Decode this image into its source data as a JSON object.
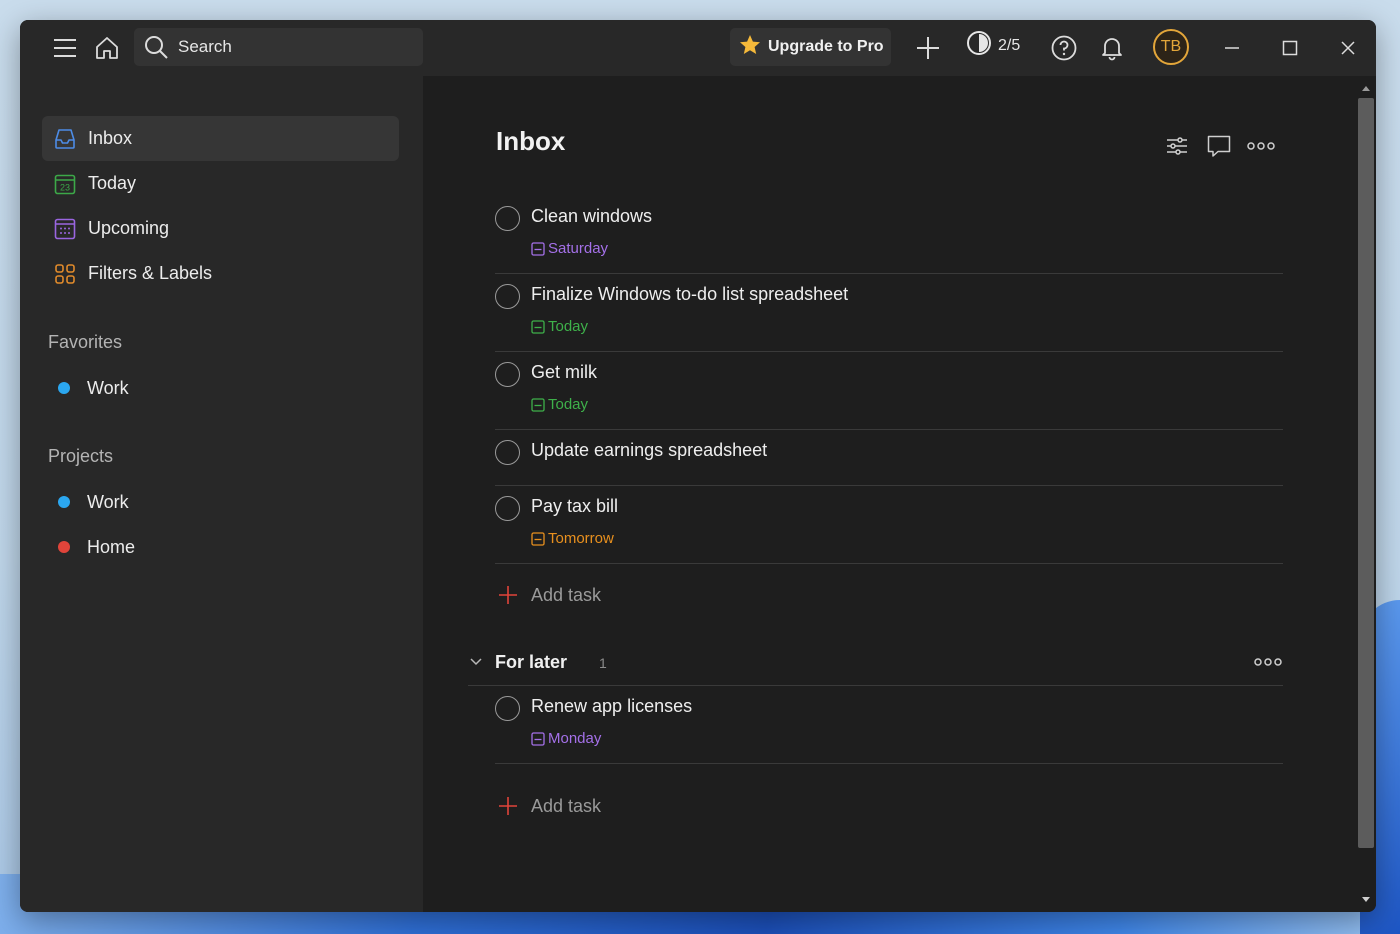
{
  "titlebar": {
    "search_placeholder": "Search",
    "upgrade_label": "Upgrade to Pro",
    "karma_count": "2/5",
    "avatar_initials": "TB"
  },
  "sidebar": {
    "nav": [
      {
        "label": "Inbox",
        "icon": "inbox-icon",
        "color": "#4d8ce6"
      },
      {
        "label": "Today",
        "icon": "calendar-today-icon",
        "color": "#3ca848"
      },
      {
        "label": "Upcoming",
        "icon": "calendar-grid-icon",
        "color": "#9a65e0"
      },
      {
        "label": "Filters & Labels",
        "icon": "filters-grid-icon",
        "color": "#e08a2b"
      }
    ],
    "today_day": "23",
    "favorites_title": "Favorites",
    "favorites": [
      {
        "label": "Work",
        "color": "#2ba7f0"
      }
    ],
    "projects_title": "Projects",
    "projects": [
      {
        "label": "Work",
        "color": "#2ba7f0"
      },
      {
        "label": "Home",
        "color": "#e0443a"
      }
    ]
  },
  "main": {
    "title": "Inbox",
    "tasks": [
      {
        "title": "Clean windows",
        "date": "Saturday",
        "date_color": "#a470e8"
      },
      {
        "title": "Finalize Windows to-do list spreadsheet",
        "date": "Today",
        "date_color": "#3eb04a"
      },
      {
        "title": "Get milk",
        "date": "Today",
        "date_color": "#3eb04a"
      },
      {
        "title": "Update earnings spreadsheet",
        "date": "",
        "date_color": ""
      },
      {
        "title": "Pay tax bill",
        "date": "Tomorrow",
        "date_color": "#e8901e"
      }
    ],
    "add_task_label": "Add task",
    "section": {
      "name": "For later",
      "count": "1",
      "tasks": [
        {
          "title": "Renew app licenses",
          "date": "Monday",
          "date_color": "#a470e8"
        }
      ],
      "add_task_label": "Add task"
    },
    "accent_color": "#e0443a"
  }
}
